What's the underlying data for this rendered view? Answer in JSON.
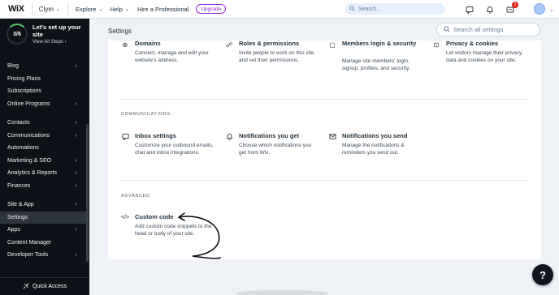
{
  "topbar": {
    "logo": "WiX",
    "site_name": "Clym",
    "explore": "Explore",
    "help": "Help",
    "hire": "Hire a Professional",
    "upgrade": "Upgrade",
    "search_placeholder": "Search...",
    "notifications_count": "2",
    "accent_color": "#9a27d5"
  },
  "sidebar": {
    "setup": {
      "progress": "3/6",
      "progress_fraction": 0.5,
      "title": "Let's set up your site",
      "link": "View All Steps"
    },
    "items": [
      {
        "label": "Blog",
        "has_arrow": true
      },
      {
        "label": "Pricing Plans",
        "has_arrow": false
      },
      {
        "label": "Subscriptions",
        "has_arrow": false
      },
      {
        "label": "Online Programs",
        "has_arrow": true
      },
      {
        "label": "Contacts",
        "has_arrow": true
      },
      {
        "label": "Communications",
        "has_arrow": true
      },
      {
        "label": "Automations",
        "has_arrow": false
      },
      {
        "label": "Marketing & SEO",
        "has_arrow": true
      },
      {
        "label": "Analytics & Reports",
        "has_arrow": true
      },
      {
        "label": "Finances",
        "has_arrow": true
      },
      {
        "label": "Site & App",
        "has_arrow": true
      },
      {
        "label": "Settings",
        "has_arrow": false,
        "active": true
      },
      {
        "label": "Apps",
        "has_arrow": true
      },
      {
        "label": "Content Manager",
        "has_arrow": false
      },
      {
        "label": "Developer Tools",
        "has_arrow": true
      }
    ],
    "quick_access": "Quick Access"
  },
  "main": {
    "page_title": "Settings",
    "search_placeholder": "Search all settings",
    "top_tiles": [
      {
        "title": "Domains",
        "desc": "Connect, manage and edit your website's address."
      },
      {
        "title": "Roles & permissions",
        "desc": "Invite people to work on this site and set their permissions."
      },
      {
        "title": "Members login & security",
        "desc": "Manage site members' login, signup, profiles, and security."
      },
      {
        "title": "Privacy & cookies",
        "desc": "Let visitors manage their privacy, data and cookies on your site."
      }
    ],
    "communications": {
      "label": "COMMUNICATIONS",
      "tiles": [
        {
          "title": "Inbox settings",
          "desc": "Customize your outbound emails, chat and inbox integrations."
        },
        {
          "title": "Notifications you get",
          "desc": "Choose which notifications you get from Wix."
        },
        {
          "title": "Notifications you send",
          "desc": "Manage the notifications & reminders you send out."
        }
      ]
    },
    "advanced": {
      "label": "ADVANCED",
      "tiles": [
        {
          "title": "Custom code",
          "desc": "Add custom code snippets to the head or body of your site."
        }
      ]
    }
  },
  "help_button": "?"
}
